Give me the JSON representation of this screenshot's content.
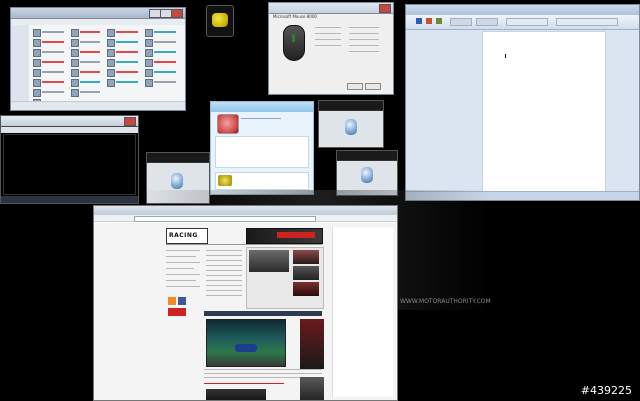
{
  "background": {
    "color": "#000000"
  },
  "watermark": "#439225",
  "background_site_text": "WWW.MOTORAUTHORITY.COM",
  "mouse_window": {
    "title": "Microsoft Mouse 8000",
    "accent": "#2e7d32"
  },
  "browser_window": {
    "site_logo": "RACING",
    "accent_red": "#cc2222"
  },
  "colors": {
    "list_red": "#e64b4b",
    "list_cyan": "#3ab0c7",
    "chat_blue": "#8fc6e8",
    "word_blue": "#2a5fb0"
  }
}
